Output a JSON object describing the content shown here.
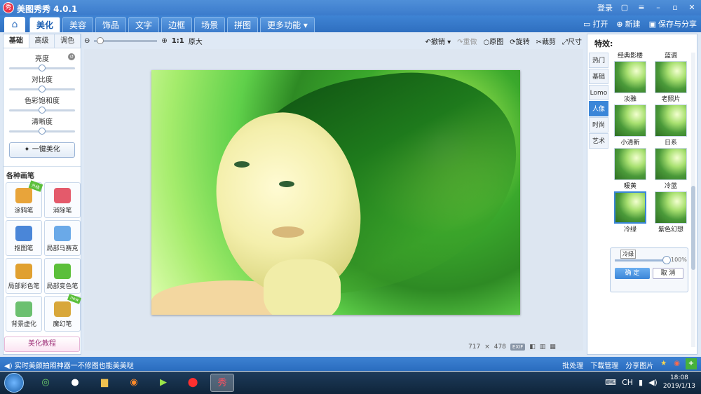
{
  "app": {
    "title": "美图秀秀 4.0.1",
    "logo_text": "秀",
    "login": "登录"
  },
  "nav": {
    "tabs": [
      "美化",
      "美容",
      "饰品",
      "文字",
      "边框",
      "场景",
      "拼图",
      "更多功能 ▾"
    ],
    "active_index": 0,
    "open": "打开",
    "new": "新建",
    "save_share": "保存与分享"
  },
  "left": {
    "subtabs": [
      "基础",
      "高级",
      "调色"
    ],
    "sliders": [
      {
        "label": "亮度",
        "value": 0.5
      },
      {
        "label": "对比度",
        "value": 0.5
      },
      {
        "label": "色彩饱和度",
        "value": 0.5
      },
      {
        "label": "清晰度",
        "value": 0.5
      }
    ],
    "one_key": "一键美化",
    "pens_title": "各种画笔",
    "pens": [
      {
        "label": "涂鸦笔",
        "badge": "升级",
        "color": "#e8a43a"
      },
      {
        "label": "消除笔",
        "badge": "",
        "color": "#e45a6b"
      },
      {
        "label": "抠图笔",
        "badge": "",
        "color": "#4a86d8"
      },
      {
        "label": "局部马赛克",
        "badge": "",
        "color": "#6aa9e8"
      },
      {
        "label": "局部彩色笔",
        "badge": "",
        "color": "#e0a030"
      },
      {
        "label": "局部变色笔",
        "badge": "",
        "color": "#5bbf3a"
      },
      {
        "label": "背景虚化",
        "badge": "",
        "color": "#6cc070"
      },
      {
        "label": "魔幻笔",
        "badge": "new",
        "color": "#d8a73a"
      }
    ],
    "tutorial": "美化教程"
  },
  "toolbar": {
    "ratio": "1:1",
    "original_size": "原大",
    "zoom_value": 0.1,
    "undo": "撤销",
    "redo": "重做",
    "original": "原图",
    "rotate": "旋转",
    "crop": "裁剪",
    "resize": "尺寸"
  },
  "image_info": {
    "width": "717",
    "times": "×",
    "height": "478",
    "exif": "EXIF"
  },
  "right": {
    "title": "特效:",
    "categories": [
      "热门",
      "基础",
      "Lomo",
      "人像",
      "时尚",
      "艺术"
    ],
    "active_category": 3,
    "effects": [
      "经典影楼",
      "蓝调",
      "淡雅",
      "老照片",
      "小清新",
      "日系",
      "暖黄",
      "冷蓝",
      "冷绿",
      "紫色幻想"
    ],
    "selected_effect": 6,
    "tooltip": "冷绿",
    "intensity": "100%",
    "ok": "确 定",
    "cancel": "取 消"
  },
  "status": {
    "left": "实时美颜拍照神器一不修图也能美美哒",
    "batch": "批处理",
    "download": "下载管理",
    "share": "分享图片"
  },
  "taskbar": {
    "time": "18:08",
    "date": "2019/1/13",
    "tray_label": "CH"
  }
}
